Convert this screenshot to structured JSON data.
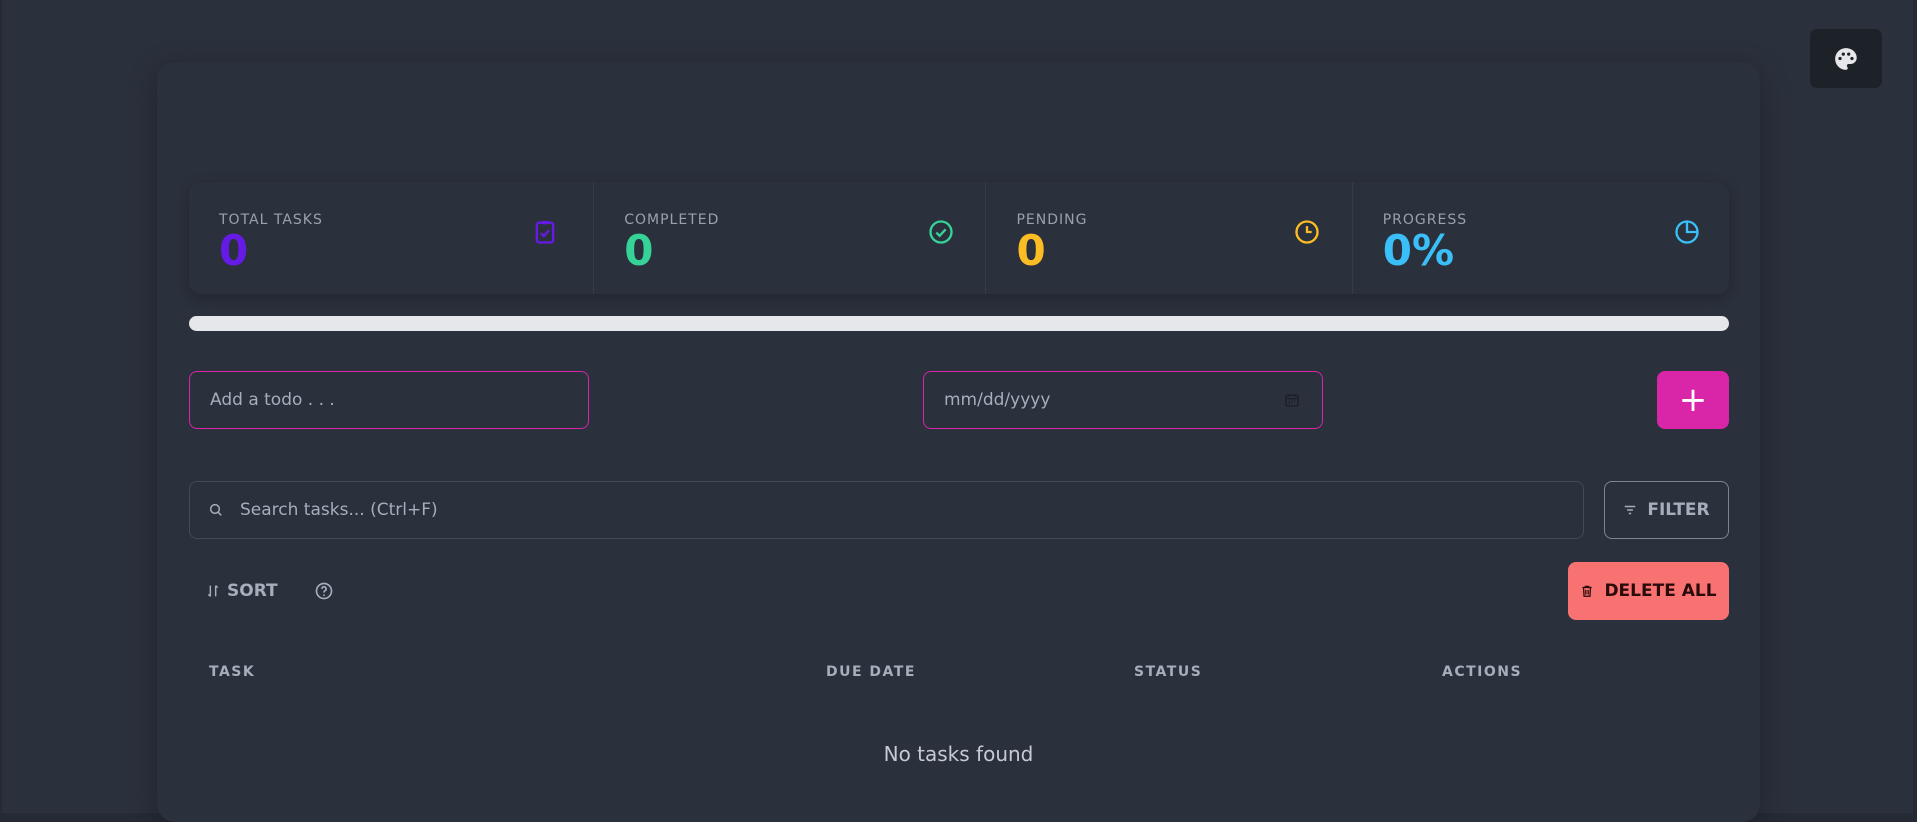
{
  "theme_button": {
    "icon": "palette-icon"
  },
  "stats": [
    {
      "title": "TOTAL TASKS",
      "value": "0",
      "color": "#661ae6",
      "icon": "clipboard-check-icon"
    },
    {
      "title": "COMPLETED",
      "value": "0",
      "color": "#36d399",
      "icon": "check-circle-icon"
    },
    {
      "title": "PENDING",
      "value": "0",
      "color": "#fbbd23",
      "icon": "clock-icon"
    },
    {
      "title": "PROGRESS",
      "value": "0%",
      "color": "#3abff8",
      "icon": "pie-chart-icon"
    }
  ],
  "progress": {
    "percent": 0
  },
  "add_form": {
    "todo_placeholder": "Add a todo . . .",
    "date_placeholder": "mm/dd/yyyy",
    "add_label": "+"
  },
  "search": {
    "placeholder": "Search tasks... (Ctrl+F)"
  },
  "filter": {
    "label": "FILTER"
  },
  "sort": {
    "label": "SORT"
  },
  "delete_all": {
    "label": "DELETE ALL"
  },
  "table": {
    "headers": [
      "TASK",
      "DUE DATE",
      "STATUS",
      "ACTIONS"
    ],
    "empty_message": "No tasks found"
  },
  "colors": {
    "accent": "#d926a9",
    "danger": "#f87272",
    "background": "#2a303c"
  }
}
